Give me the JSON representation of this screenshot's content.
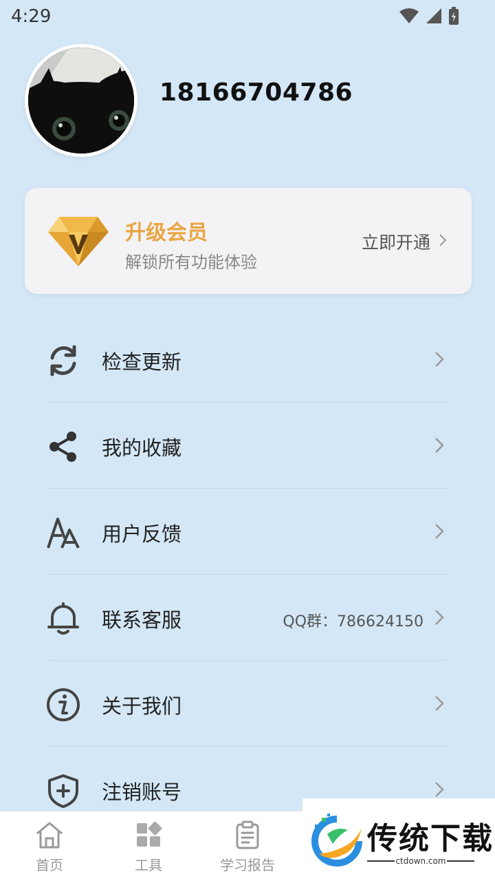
{
  "status_bar": {
    "time": "4:29"
  },
  "profile": {
    "username": "18166704786"
  },
  "vip": {
    "title": "升级会员",
    "subtitle": "解锁所有功能体验",
    "action": "立即开通",
    "accent": "#e9a543"
  },
  "menu": [
    {
      "label": "检查更新",
      "icon": "refresh-icon",
      "extra": ""
    },
    {
      "label": "我的收藏",
      "icon": "share-icon",
      "extra": ""
    },
    {
      "label": "用户反馈",
      "icon": "font-icon",
      "extra": ""
    },
    {
      "label": "联系客服",
      "icon": "bell-icon",
      "extra": "QQ群：786624150"
    },
    {
      "label": "关于我们",
      "icon": "info-icon",
      "extra": ""
    },
    {
      "label": "注销账号",
      "icon": "shield-plus-icon",
      "extra": ""
    }
  ],
  "bottom_nav": [
    {
      "label": "首页",
      "icon": "home-icon"
    },
    {
      "label": "工具",
      "icon": "grid-icon"
    },
    {
      "label": "学习报告",
      "icon": "clipboard-icon"
    }
  ],
  "watermark": {
    "title": "传统下载",
    "site": "ctdown.com"
  }
}
